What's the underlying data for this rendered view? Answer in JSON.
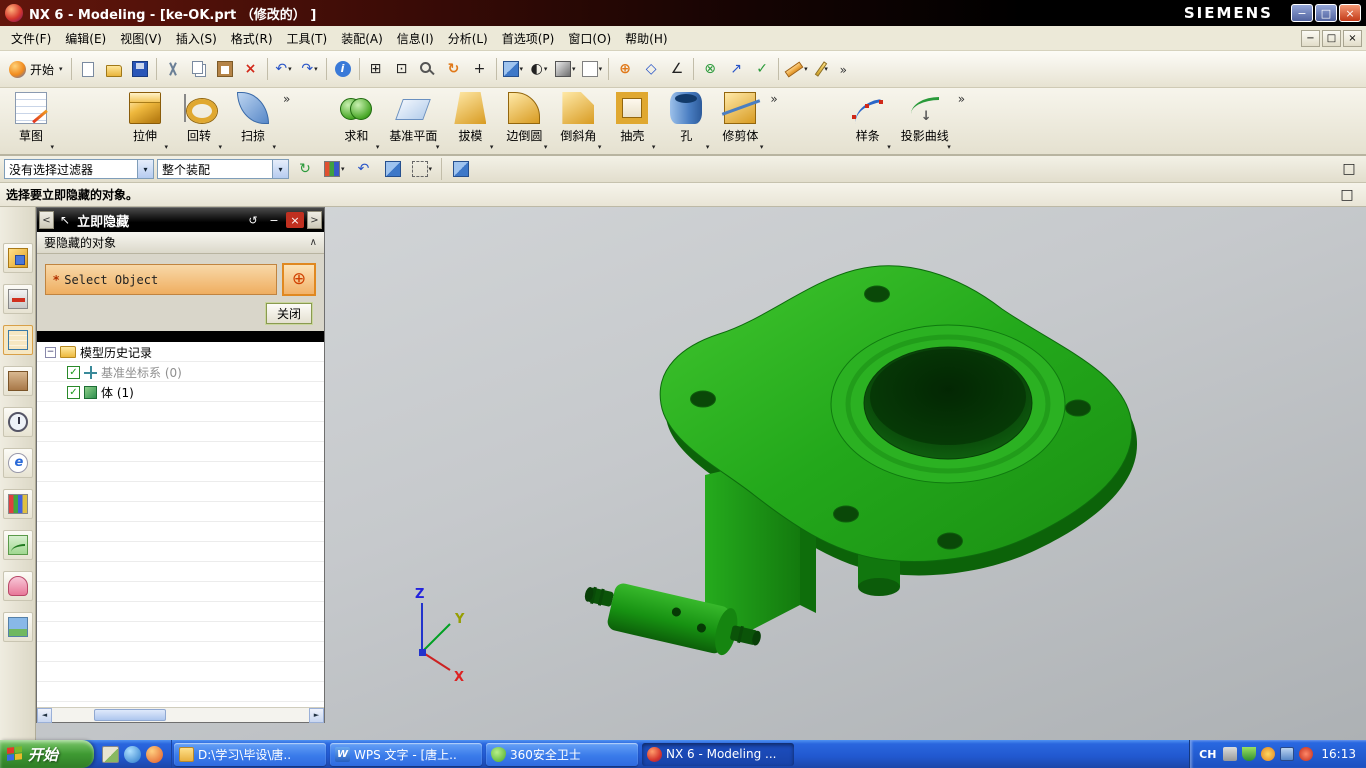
{
  "icons": {
    "minimize": "−",
    "restore": "□",
    "close": "×",
    "undo": "↶",
    "redo": "↷",
    "delete": "×",
    "rotate": "↻",
    "fit": "⊞",
    "zoom_box": "⊡",
    "pan": "+",
    "info": "i",
    "half_shade": "◐",
    "snap_point": "⊕",
    "snap_diamond": "◇",
    "snap_angle": "∠",
    "quick_pick": "⊗",
    "vector": "↗",
    "confirm": "✓",
    "overflow": "»",
    "back": "<",
    "forward": ">",
    "cursor": "↖",
    "reset": "↺",
    "collapse": "∧",
    "select_scope": "⊕",
    "h_left": "◄",
    "h_right": "►",
    "tree_collapse": "−",
    "check": "✓",
    "refresh": "↻",
    "mini_undo": "↶"
  },
  "titlebar": {
    "title": "NX 6 - Modeling - [ke-OK.prt （修改的） ]",
    "brand": "SIEMENS"
  },
  "menu": {
    "items": [
      "文件(F)",
      "编辑(E)",
      "视图(V)",
      "插入(S)",
      "格式(R)",
      "工具(T)",
      "装配(A)",
      "信息(I)",
      "分析(L)",
      "首选项(P)",
      "窗口(O)",
      "帮助(H)"
    ]
  },
  "toolbar": {
    "start_label": "开始"
  },
  "features": {
    "items": [
      {
        "label": "草图"
      },
      {
        "label": "拉伸"
      },
      {
        "label": "回转"
      },
      {
        "label": "扫掠"
      },
      {
        "label": "求和"
      },
      {
        "label": "基准平面"
      },
      {
        "label": "拔模"
      },
      {
        "label": "边倒圆"
      },
      {
        "label": "倒斜角"
      },
      {
        "label": "抽壳"
      },
      {
        "label": "孔"
      },
      {
        "label": "修剪体"
      },
      {
        "label": "样条"
      },
      {
        "label": "投影曲线"
      }
    ]
  },
  "selection_bar": {
    "filter": "没有选择过滤器",
    "scope": "整个装配"
  },
  "prompt": {
    "text": "选择要立即隐藏的对象。"
  },
  "dialog": {
    "title": "立即隐藏",
    "section": "要隐藏的对象",
    "asterisk": "*",
    "select_label": "Select Object",
    "close_label": "关闭"
  },
  "navigator": {
    "rows": [
      {
        "label": "模型历史记录"
      },
      {
        "label": "基准坐标系 (0)"
      },
      {
        "label": "体 (1)"
      }
    ]
  },
  "viewport": {
    "axis_x": "X",
    "axis_y": "Y",
    "axis_z": "Z",
    "model_color": "#23a81b"
  },
  "taskbar": {
    "start_label": "开始",
    "tasks": [
      {
        "label": "D:\\学习\\毕设\\唐.."
      },
      {
        "label": "WPS 文字 - [唐上.."
      },
      {
        "label": "360安全卫士"
      },
      {
        "label": "NX 6 - Modeling ..."
      }
    ],
    "lang": "CH",
    "time": "16:13"
  }
}
